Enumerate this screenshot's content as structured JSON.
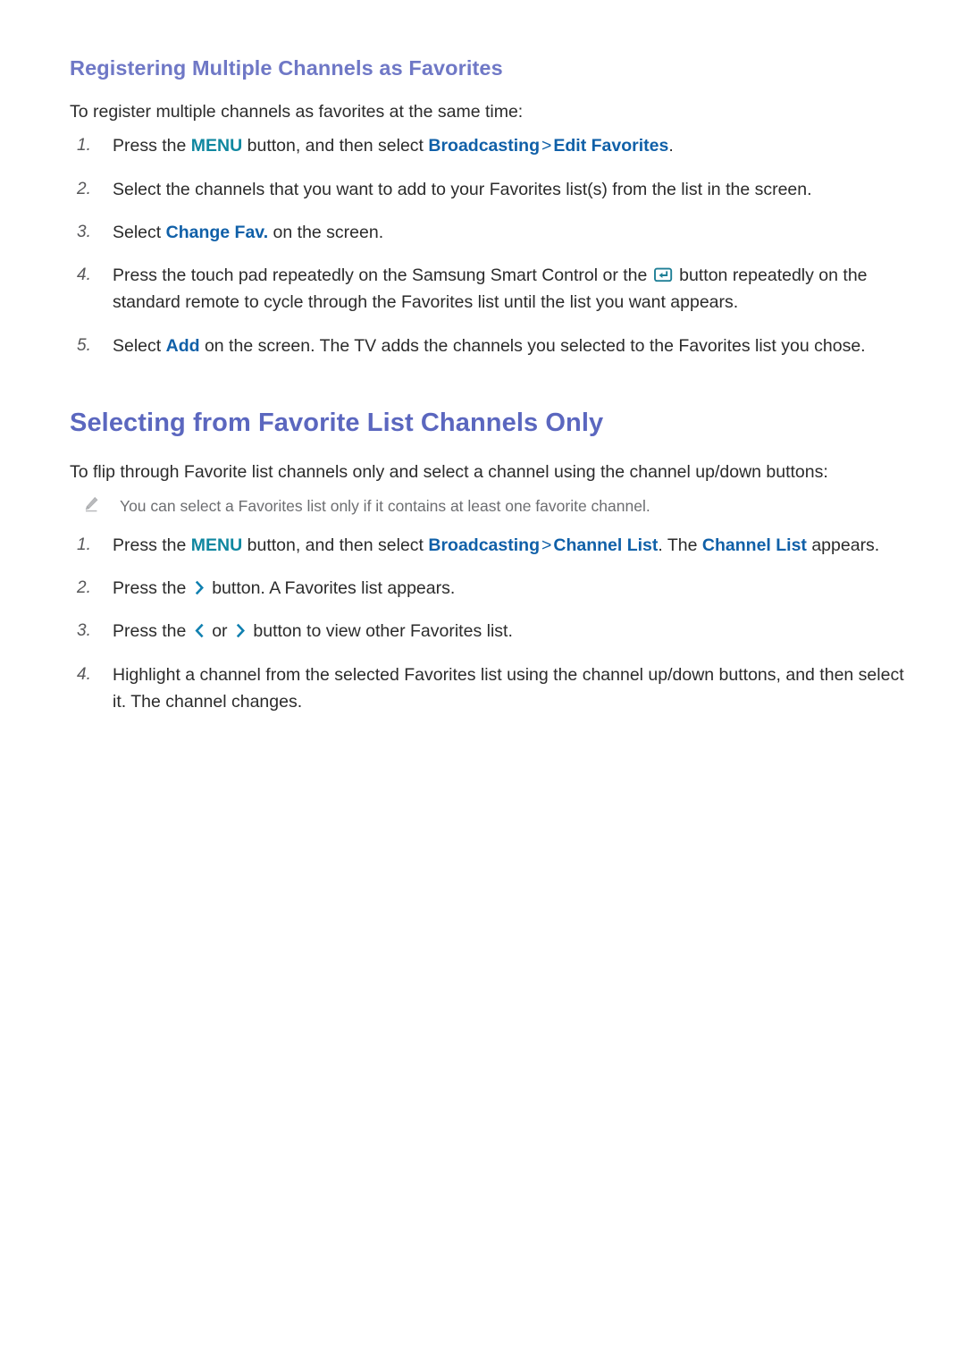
{
  "page": {
    "section1": {
      "heading": "Registering Multiple Channels as Favorites",
      "lead": "To register multiple channels as favorites at the same time:",
      "steps": [
        {
          "num": "1.",
          "parts": [
            {
              "t": "text",
              "v": "Press the "
            },
            {
              "t": "teal",
              "v": "MENU"
            },
            {
              "t": "text",
              "v": " button, and then select "
            },
            {
              "t": "blue",
              "v": "Broadcasting"
            },
            {
              "t": "sep",
              "v": ">"
            },
            {
              "t": "blue",
              "v": "Edit Favorites"
            },
            {
              "t": "text",
              "v": "."
            }
          ],
          "plain": "Press the MENU button, and then select Broadcasting > Edit Favorites."
        },
        {
          "num": "2.",
          "parts": [
            {
              "t": "text",
              "v": "Select the channels that you want to add to your Favorites list(s) from the list in the screen."
            }
          ],
          "plain": "Select the channels that you want to add to your Favorites list(s) from the list in the screen."
        },
        {
          "num": "3.",
          "parts": [
            {
              "t": "text",
              "v": "Select "
            },
            {
              "t": "blue",
              "v": "Change Fav."
            },
            {
              "t": "text",
              "v": " on the screen."
            }
          ],
          "plain": "Select Change Fav. on the screen."
        },
        {
          "num": "4.",
          "parts": [
            {
              "t": "text",
              "v": "Press the touch pad repeatedly on the Samsung Smart Control or the "
            },
            {
              "t": "icon",
              "v": "enter-button-icon"
            },
            {
              "t": "text",
              "v": " button repeatedly on the standard remote to cycle through the Favorites list until the list you want appears."
            }
          ],
          "plain": "Press the touch pad repeatedly on the Samsung Smart Control or the [Enter] button repeatedly on the standard remote to cycle through the Favorites list until the list you want appears."
        },
        {
          "num": "5.",
          "parts": [
            {
              "t": "text",
              "v": "Select "
            },
            {
              "t": "blue",
              "v": "Add"
            },
            {
              "t": "text",
              "v": " on the screen. The TV adds the channels you selected to the Favorites list you chose."
            }
          ],
          "plain": "Select Add on the screen. The TV adds the channels you selected to the Favorites list you chose."
        }
      ]
    },
    "section2": {
      "heading": "Selecting from Favorite List Channels Only",
      "lead": "To flip through Favorite list channels only and select a channel using the channel up/down buttons:",
      "note": {
        "icon": "pencil-icon",
        "text": "You can select a Favorites list only if it contains at least one favorite channel."
      },
      "steps": [
        {
          "num": "1.",
          "parts": [
            {
              "t": "text",
              "v": "Press the "
            },
            {
              "t": "teal",
              "v": "MENU"
            },
            {
              "t": "text",
              "v": " button, and then select "
            },
            {
              "t": "blue",
              "v": "Broadcasting"
            },
            {
              "t": "sep",
              "v": ">"
            },
            {
              "t": "blue",
              "v": "Channel List"
            },
            {
              "t": "text",
              "v": ". The "
            },
            {
              "t": "blue",
              "v": "Channel List"
            },
            {
              "t": "text",
              "v": " appears."
            }
          ],
          "plain": "Press the MENU button, and then select Broadcasting > Channel List. The Channel List appears."
        },
        {
          "num": "2.",
          "parts": [
            {
              "t": "text",
              "v": "Press the "
            },
            {
              "t": "icon",
              "v": "chevron-right-icon"
            },
            {
              "t": "text",
              "v": " button. A Favorites list appears."
            }
          ],
          "plain": "Press the > button. A Favorites list appears."
        },
        {
          "num": "3.",
          "parts": [
            {
              "t": "text",
              "v": "Press the "
            },
            {
              "t": "icon",
              "v": "chevron-left-icon"
            },
            {
              "t": "text",
              "v": " or "
            },
            {
              "t": "icon",
              "v": "chevron-right-icon"
            },
            {
              "t": "text",
              "v": " button to view other Favorites list."
            }
          ],
          "plain": "Press the < or > button to view other Favorites list."
        },
        {
          "num": "4.",
          "parts": [
            {
              "t": "text",
              "v": "Highlight a channel from the selected Favorites list using the channel up/down buttons, and then select it. The channel changes."
            }
          ],
          "plain": "Highlight a channel from the selected Favorites list using the channel up/down buttons, and then select it. The channel changes."
        }
      ]
    }
  },
  "colors": {
    "sub_heading": "#6f78c6",
    "main_heading": "#5b67bf",
    "keyword_teal": "#0f87a0",
    "keyword_blue": "#1060a8",
    "body_text": "#2b2b2b",
    "note_text": "#6d6e71",
    "list_number": "#58585a",
    "icon_teal": "#1e7f96",
    "chevron_blue": "#1080b0",
    "background": "#ffffff"
  }
}
